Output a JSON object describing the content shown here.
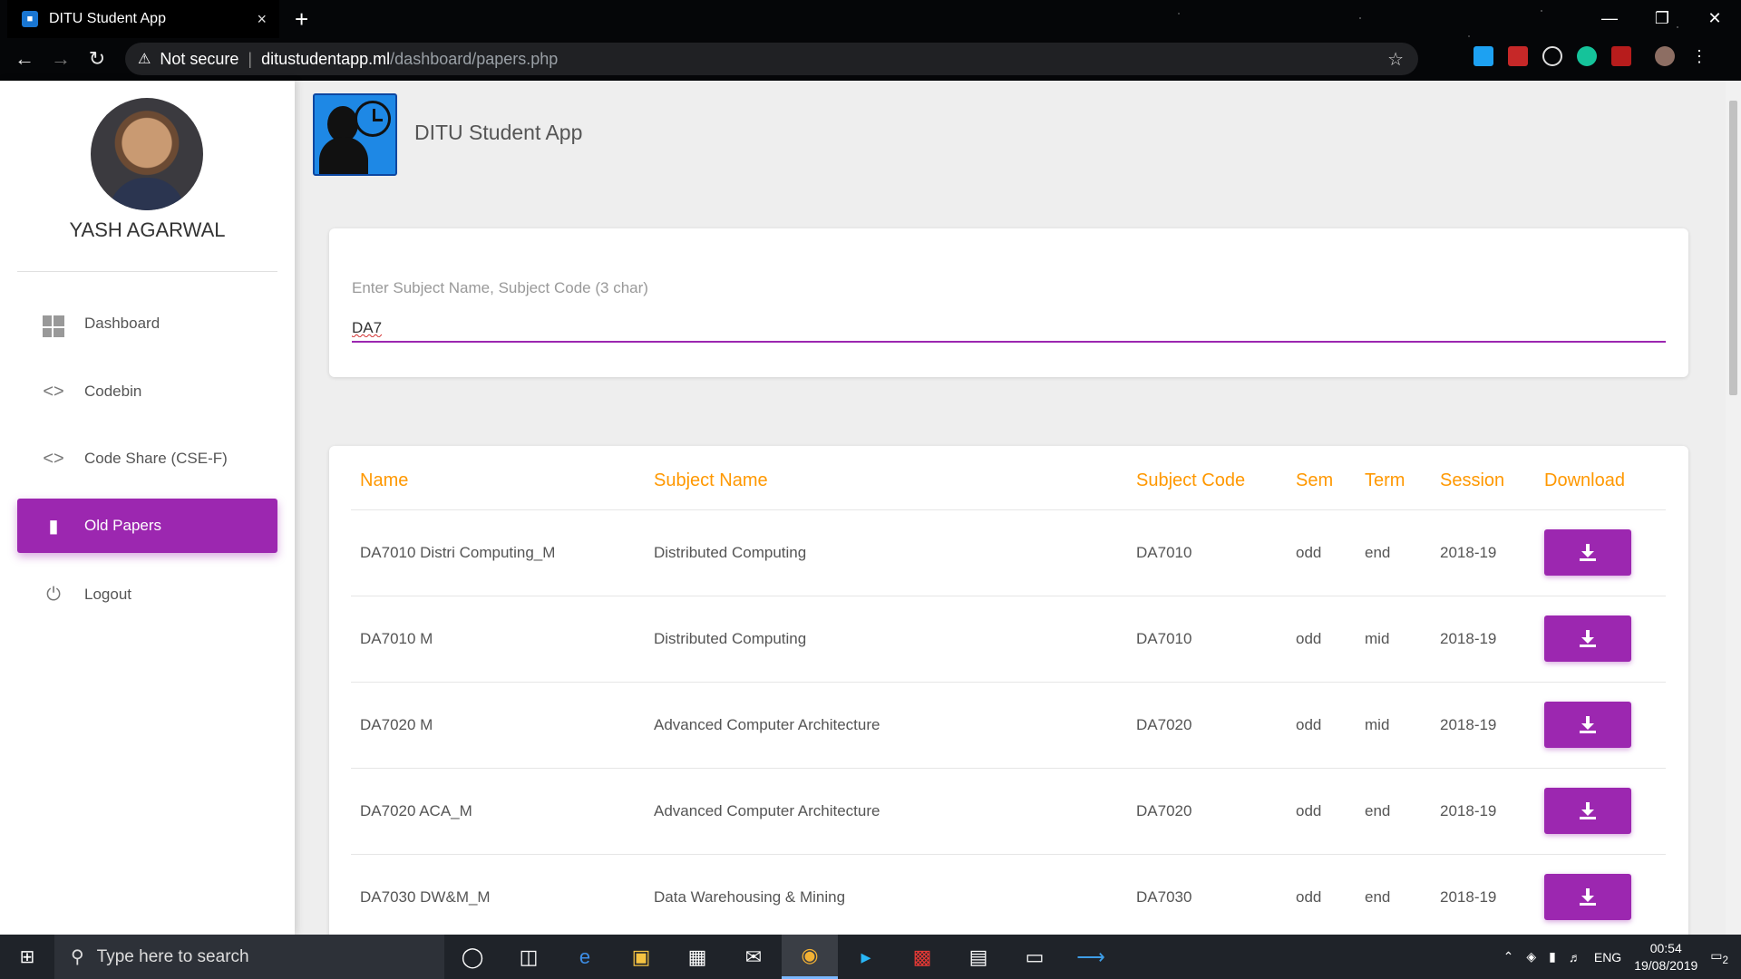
{
  "browser": {
    "tab_title": "DITU Student App",
    "tab_close": "×",
    "new_tab": "+",
    "security_text": "Not secure",
    "url_domain": "ditustudentapp.ml",
    "url_path": "/dashboard/papers.php"
  },
  "sidebar": {
    "user_name": "YASH AGARWAL",
    "items": [
      {
        "label": "Dashboard"
      },
      {
        "label": "Codebin"
      },
      {
        "label": "Code Share (CSE-F)"
      },
      {
        "label": "Old Papers"
      },
      {
        "label": "Logout"
      }
    ]
  },
  "app": {
    "title": "DITU Student App"
  },
  "search": {
    "label": "Enter Subject Name, Subject Code (3 char)",
    "value": "DA7"
  },
  "papers": {
    "headers": [
      "Name",
      "Subject Name",
      "Subject Code",
      "Sem",
      "Term",
      "Session",
      "Download"
    ],
    "rows": [
      {
        "name": "DA7010 Distri Computing_M",
        "subject": "Distributed Computing",
        "code": "DA7010",
        "sem": "odd",
        "term": "end",
        "session": "2018-19"
      },
      {
        "name": "DA7010 M",
        "subject": "Distributed Computing",
        "code": "DA7010",
        "sem": "odd",
        "term": "mid",
        "session": "2018-19"
      },
      {
        "name": "DA7020 M",
        "subject": "Advanced Computer Architecture",
        "code": "DA7020",
        "sem": "odd",
        "term": "mid",
        "session": "2018-19"
      },
      {
        "name": "DA7020 ACA_M",
        "subject": "Advanced Computer Architecture",
        "code": "DA7020",
        "sem": "odd",
        "term": "end",
        "session": "2018-19"
      },
      {
        "name": "DA7030 DW&M_M",
        "subject": "Data Warehousing & Mining",
        "code": "DA7030",
        "sem": "odd",
        "term": "end",
        "session": "2018-19"
      }
    ]
  },
  "taskbar": {
    "search_placeholder": "Type here to search",
    "language": "ENG",
    "time": "00:54",
    "date": "19/08/2019",
    "notification_count": "2"
  },
  "colors": {
    "accent": "#9c27b0",
    "header_text": "#ff9800"
  }
}
